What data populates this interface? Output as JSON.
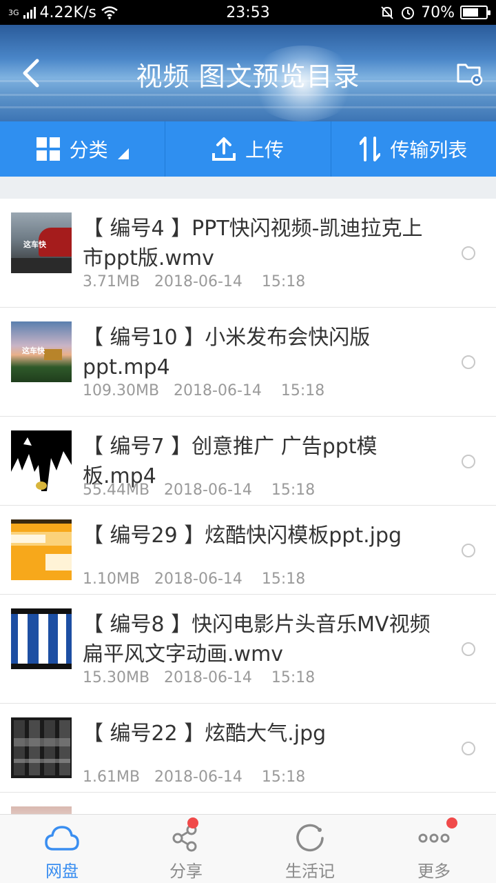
{
  "status_bar": {
    "network": "3G",
    "speed": "4.22K/s",
    "time": "23:53",
    "battery": "70%",
    "battery_level": 0.7
  },
  "header": {
    "title": "视频  图文预览目录"
  },
  "toolbar": {
    "category_label": "分类",
    "upload_label": "上传",
    "transfer_label": "传输列表"
  },
  "files": [
    {
      "name": "【 编号4 】PPT快闪视频-凯迪拉克上市ppt版.wmv",
      "size": "3.71MB",
      "date": "2018-06-14",
      "time": "15:18"
    },
    {
      "name": "【 编号10 】小米发布会快闪版ppt.mp4",
      "size": "109.30MB",
      "date": "2018-06-14",
      "time": "15:18"
    },
    {
      "name": "【 编号7 】创意推广 广告ppt模板.mp4",
      "size": "55.44MB",
      "date": "2018-06-14",
      "time": "15:18"
    },
    {
      "name": "【 编号29 】炫酷快闪模板ppt.jpg",
      "size": "1.10MB",
      "date": "2018-06-14",
      "time": "15:18"
    },
    {
      "name": "【 编号8 】快闪电影片头音乐MV视频扁平风文字动画.wmv",
      "size": "15.30MB",
      "date": "2018-06-14",
      "time": "15:18"
    },
    {
      "name": "【 编号22 】炫酷大气.jpg",
      "size": "1.61MB",
      "date": "2018-06-14",
      "time": "15:18"
    }
  ],
  "thumb_text": {
    "car": "这车快",
    "house": "这车快"
  },
  "bottom_nav": [
    {
      "label": "网盘",
      "icon": "cloud-icon",
      "active": true
    },
    {
      "label": "分享",
      "icon": "share-icon",
      "badge": true
    },
    {
      "label": "生活记",
      "icon": "life-record-icon"
    },
    {
      "label": "更多",
      "icon": "more-dots-icon",
      "badge": true
    }
  ],
  "colors": {
    "toolbar_blue": "#2f8ff0",
    "active_nav": "#3a8ef0",
    "badge_red": "#f04a4a"
  }
}
